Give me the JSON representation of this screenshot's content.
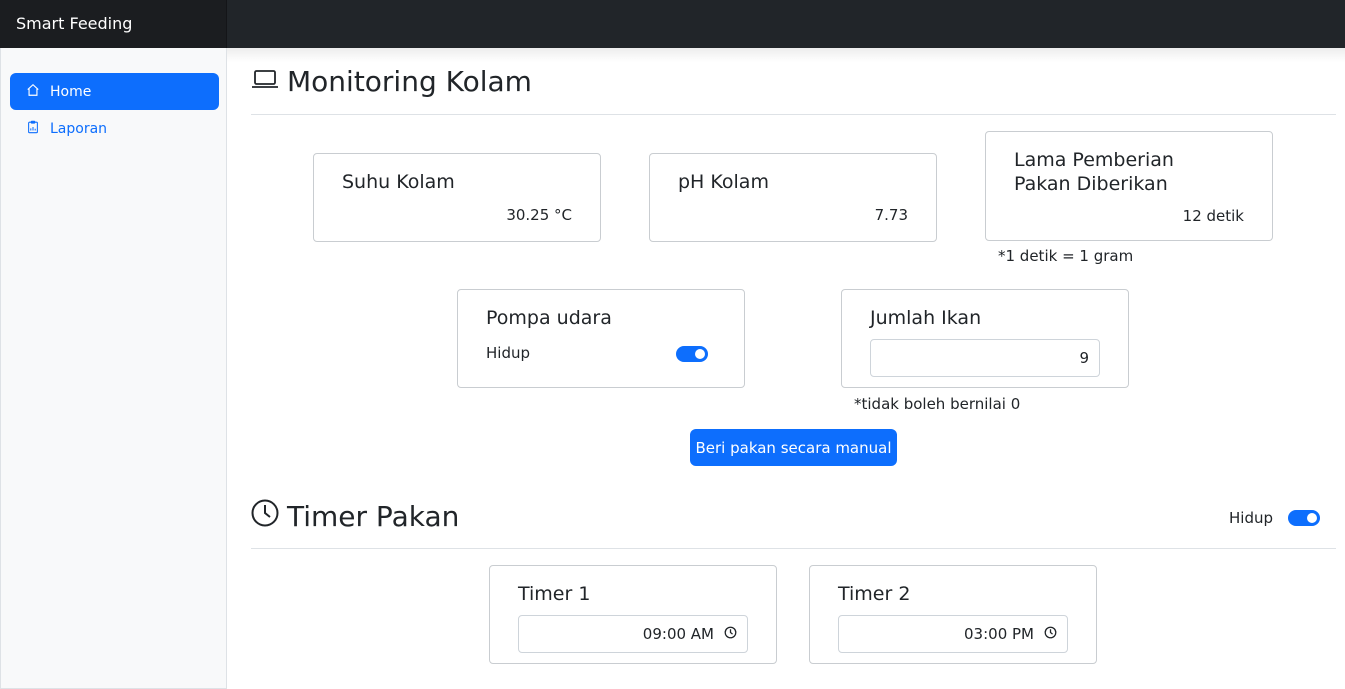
{
  "app": {
    "brand": "Smart Feeding"
  },
  "sidebar": {
    "items": [
      {
        "label": "Home",
        "icon": "home-icon",
        "active": true
      },
      {
        "label": "Laporan",
        "icon": "report-icon",
        "active": false
      }
    ]
  },
  "monitoring": {
    "title": "Monitoring Kolam",
    "icon": "laptop-icon",
    "suhu": {
      "title": "Suhu Kolam",
      "value": "30.25 °C"
    },
    "ph": {
      "title": "pH Kolam",
      "value": "7.73"
    },
    "lama": {
      "title_line1": "Lama Pemberian",
      "title_line2": "Pakan Diberikan",
      "value": "12 detik",
      "note": "*1 detik = 1 gram"
    },
    "pompa": {
      "title": "Pompa udara",
      "status": "Hidup",
      "on": true
    },
    "ikan": {
      "title": "Jumlah Ikan",
      "value": "9",
      "note": "*tidak boleh bernilai 0"
    },
    "manual_button": "Beri pakan secara manual"
  },
  "timer": {
    "title": "Timer Pakan",
    "icon": "clock-icon",
    "status": "Hidup",
    "on": true,
    "timers": [
      {
        "label": "Timer 1",
        "time": "09:00 AM"
      },
      {
        "label": "Timer 2",
        "time": "03:00 PM"
      }
    ]
  },
  "colors": {
    "primary": "#0d6efd",
    "topbar": "#212529",
    "sidebar": "#f8f9fa"
  }
}
